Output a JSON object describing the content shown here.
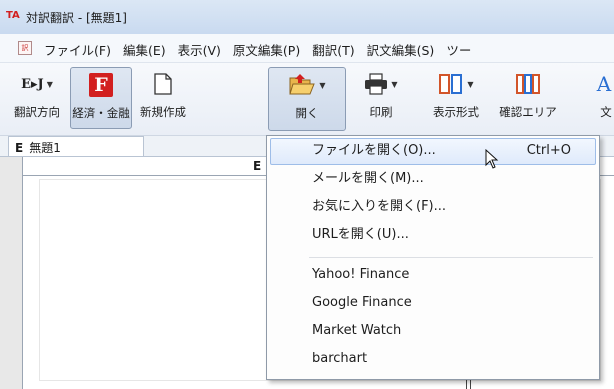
{
  "window": {
    "app_icon": "TA",
    "title": "対訳翻訳 - [無題1]"
  },
  "menubar": {
    "doc_icon": "doc-icon",
    "items": [
      {
        "label": "ファイル(F)"
      },
      {
        "label": "編集(E)"
      },
      {
        "label": "表示(V)"
      },
      {
        "label": "原文編集(P)"
      },
      {
        "label": "翻訳(T)"
      },
      {
        "label": "訳文編集(S)"
      },
      {
        "label": "ツー"
      }
    ]
  },
  "toolbar": {
    "direction": {
      "label": "翻訳方向",
      "glyph": "E▸J"
    },
    "field": {
      "label": "経済・金融",
      "glyph": "F"
    },
    "new": {
      "label": "新規作成"
    },
    "open": {
      "label": "開く"
    },
    "print": {
      "label": "印刷"
    },
    "display": {
      "label": "表示形式"
    },
    "confirm": {
      "label": "確認エリア"
    },
    "partial": {
      "label": "文"
    }
  },
  "tabs": [
    {
      "label": "無題1",
      "prefix": "E"
    }
  ],
  "document": {
    "header_label": "E"
  },
  "open_menu": {
    "items": [
      {
        "label": "ファイルを開く(O)...",
        "shortcut": "Ctrl+O"
      },
      {
        "label": "メールを開く(M)..."
      },
      {
        "label": "お気に入りを開く(F)..."
      },
      {
        "label": "URLを開く(U)..."
      }
    ],
    "favorites": [
      {
        "label": "Yahoo! Finance"
      },
      {
        "label": "Google Finance"
      },
      {
        "label": "Market Watch"
      },
      {
        "label": "barchart"
      }
    ]
  },
  "colors": {
    "accent_red": "#d21f1f",
    "hover_border": "#9ebde8"
  }
}
